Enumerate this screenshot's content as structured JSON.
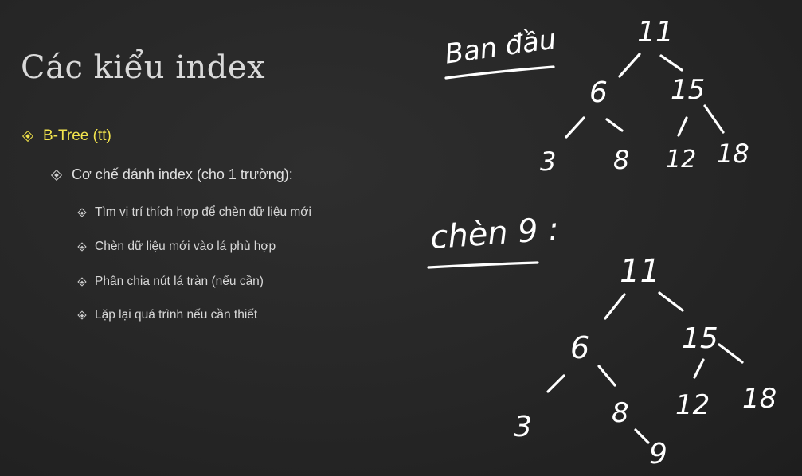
{
  "slide": {
    "title": "Các kiểu index",
    "bullet_l1": "B-Tree (tt)",
    "bullet_l2": "Cơ chế đánh index (cho 1 trường):",
    "bullets_l3": [
      "Tìm vị trí thích hợp để chèn dữ liệu mới",
      "Chèn dữ liệu mới vào lá phù hợp",
      "Phân chia nút lá tràn (nếu cần)",
      "Lặp lại quá trình nếu cần thiết"
    ]
  },
  "handwriting": {
    "label_initial": "Ban đầu",
    "label_insert": "chèn 9 :",
    "tree_initial": {
      "root": "11",
      "internal": [
        "6",
        "15"
      ],
      "leaves": [
        "3",
        "8",
        "12",
        "18"
      ]
    },
    "tree_after": {
      "root": "11",
      "internal": [
        "6",
        "15"
      ],
      "leaves": [
        "3",
        "8",
        "12",
        "18"
      ],
      "new": "9"
    }
  },
  "colors": {
    "background": "#262626",
    "accent": "#f0e24a",
    "text": "#e0e0e0",
    "ink": "#ffffff"
  }
}
